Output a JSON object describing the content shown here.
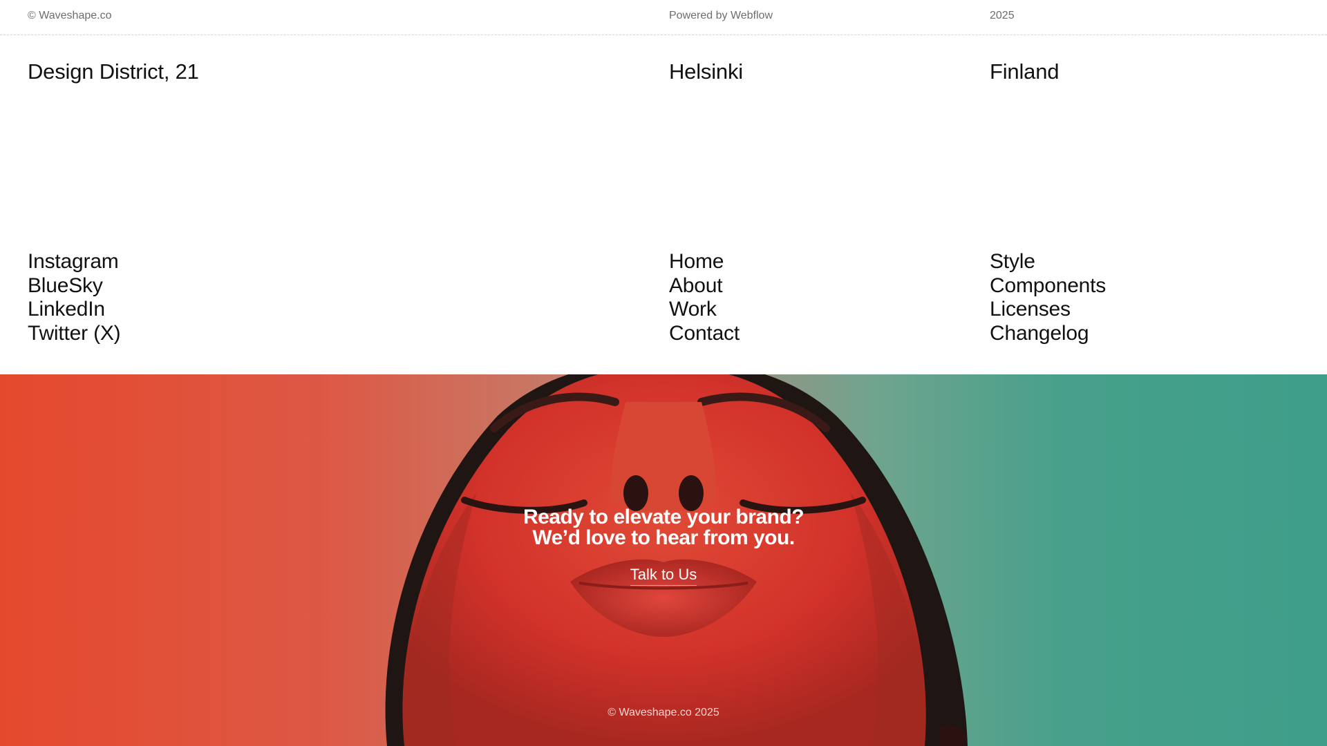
{
  "meta": {
    "copyright": "© Waveshape.co",
    "powered_by": "Powered by Webflow",
    "year": "2025"
  },
  "address": {
    "street": "Design District, 21",
    "city": "Helsinki",
    "country": "Finland"
  },
  "social_links": [
    "Instagram",
    "BlueSky",
    "LinkedIn",
    "Twitter (X)"
  ],
  "nav_links": [
    "Home",
    "About",
    "Work",
    "Contact"
  ],
  "resource_links": [
    "Style",
    "Components",
    "Licenses",
    "Changelog"
  ],
  "hero": {
    "headline_line1": "Ready to elevate your brand?",
    "headline_line2": "We’d love to hear from you.",
    "cta_label": "Talk to Us",
    "copyright": "© Waveshape.co 2025"
  },
  "colors": {
    "background": "#ffffff",
    "text": "#111111",
    "muted_text": "#6d6d6d",
    "hero_red": "#e5492d",
    "hero_teal": "#3e9e89",
    "face_red": "#d63327"
  }
}
